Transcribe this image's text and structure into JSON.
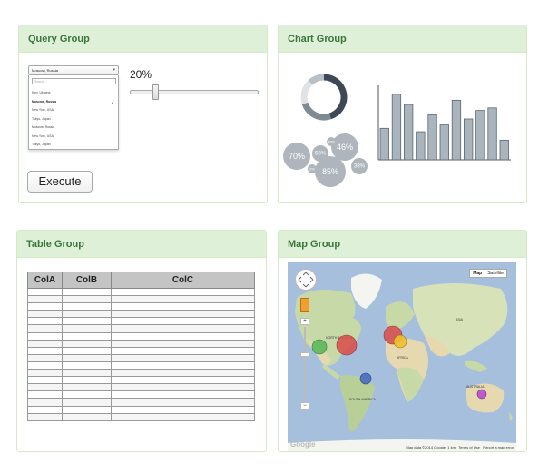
{
  "query_group": {
    "title": "Query Group",
    "select_value": "Moscow, Russia",
    "search_placeholder": "Search...",
    "options": [
      "Kiev, Ukraine",
      "Moscow, Russia",
      "New York, USA",
      "Tokyo, Japan",
      "Moscow, Russia",
      "New York, USA",
      "Tokyo, Japan"
    ],
    "selected_index": 1,
    "percent_label": "20%",
    "slider_value_pct": 20,
    "execute_label": "Execute"
  },
  "chart_group": {
    "title": "Chart Group",
    "colors": {
      "dark": "#3d4a55",
      "mid": "#8e9aa3",
      "light": "#dfe3e6",
      "bubble": "#aeb5bc",
      "bar": "#aab4bc",
      "bar_stroke": "#5a6670"
    }
  },
  "chart_data": [
    {
      "type": "pie",
      "values": [
        45,
        25,
        18,
        12
      ],
      "colors": [
        "#3d4a55",
        "#7f8b94",
        "#dfe3e6",
        "#b9c1c7"
      ]
    },
    {
      "type": "scatter",
      "kind": "bubble",
      "labels": [
        "70%",
        "58%",
        "46%",
        "49%",
        "85%",
        "38%",
        "3%"
      ],
      "values": [
        70,
        58,
        46,
        49,
        85,
        38,
        3
      ]
    },
    {
      "type": "bar",
      "values": [
        37,
        77,
        65,
        33,
        53,
        41,
        70,
        48,
        58,
        61,
        23
      ]
    }
  ],
  "table_group": {
    "title": "Table Group",
    "columns": [
      "ColA",
      "ColB",
      "ColC"
    ],
    "row_count": 18
  },
  "map_group": {
    "title": "Map Group",
    "map_types": [
      "Map",
      "Satellite"
    ],
    "attribution": "Map data ©2014 Google",
    "scale": "1 km",
    "terms": "Terms of Use",
    "report": "Report a map error",
    "logo": "Google",
    "labels": [
      "NORTH AMERICA",
      "AFRICA",
      "ASIA",
      "SOUTH AMERICA",
      "AUSTRALIA"
    ],
    "markers": [
      {
        "name": "north-america-large",
        "color": "#d9534f"
      },
      {
        "name": "north-america-green",
        "color": "#5cb85c"
      },
      {
        "name": "europe-red",
        "color": "#d9534f"
      },
      {
        "name": "europe-yellow",
        "color": "#f0c030"
      },
      {
        "name": "south-america-blue",
        "color": "#4a6fc0"
      },
      {
        "name": "australia-purple",
        "color": "#b84fd0"
      }
    ]
  }
}
